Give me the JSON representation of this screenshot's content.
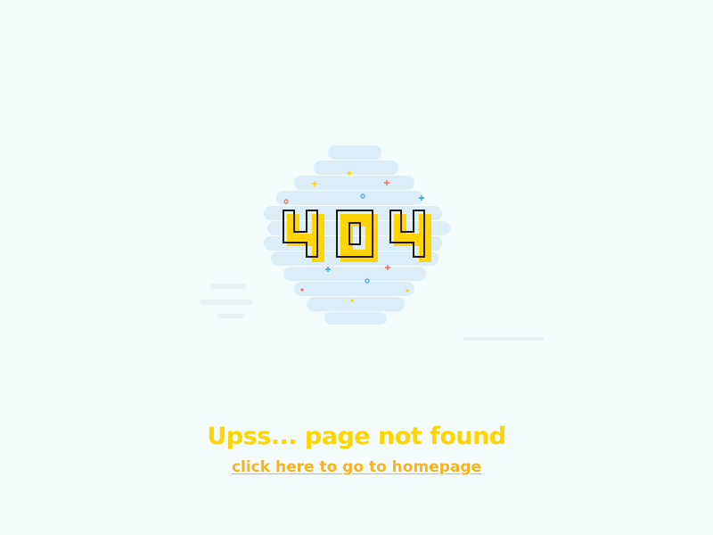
{
  "error": {
    "code": "404",
    "message": "Upss... page not found",
    "link_label": "click here to go to homepage"
  },
  "colors": {
    "background": "#f3fbfb",
    "cloud": "#dbeef7",
    "digit_fill": "#ffd400",
    "digit_outline": "#1a1a1a",
    "message": "#ffd400",
    "link": "#f7b322"
  },
  "icons": [
    "cloud-illustration",
    "sparkle-icon"
  ]
}
